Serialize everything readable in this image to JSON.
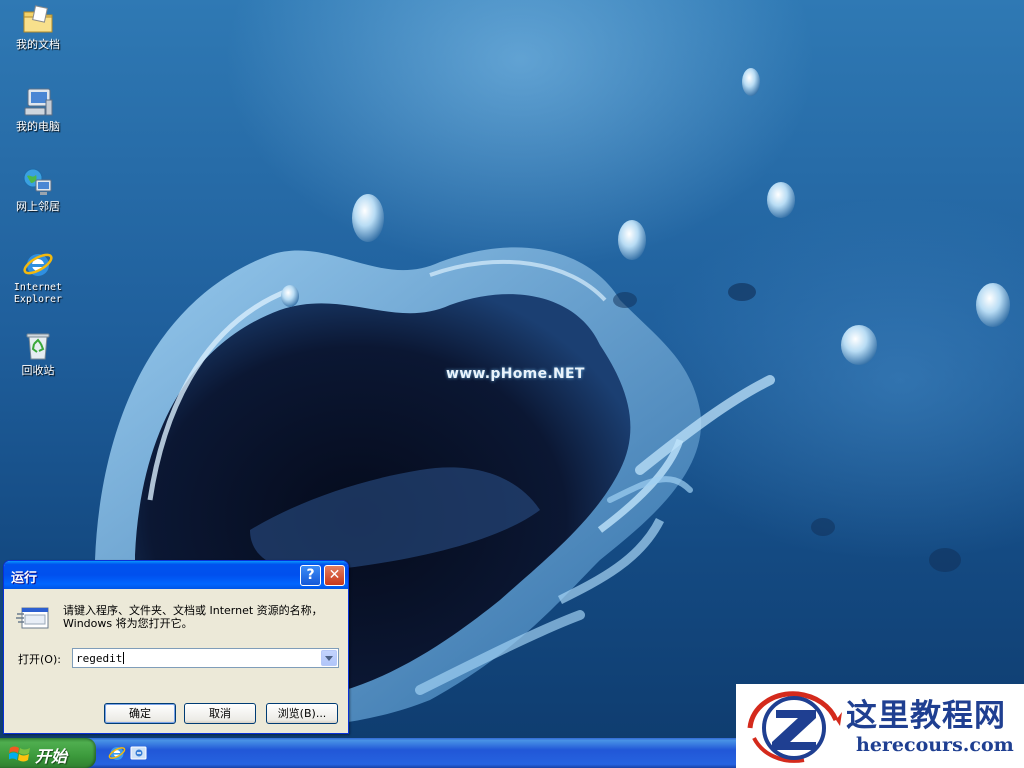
{
  "desktop": {
    "watermark": "www.pHome.NET",
    "icons": [
      {
        "label": "我的文档"
      },
      {
        "label": "我的电脑"
      },
      {
        "label": "网上邻居"
      },
      {
        "label": "Internet Explorer"
      },
      {
        "label": "回收站"
      }
    ]
  },
  "run_dialog": {
    "title": "运行",
    "help_glyph": "?",
    "close_glyph": "✕",
    "description": "请键入程序、文件夹、文档或 Internet 资源的名称，Windows 将为您打开它。",
    "open_label": "打开(O):",
    "command_value": "regedit",
    "ok_label": "确定",
    "cancel_label": "取消",
    "browse_label": "浏览(B)..."
  },
  "taskbar": {
    "start_label": "开始",
    "quick_launch": [
      "internet-explorer-icon",
      "show-desktop-icon"
    ]
  },
  "brand": {
    "title": "这里教程网",
    "url": "herecours.com"
  },
  "colors": {
    "titlebar": "#0053ee",
    "start_button": "#3c9a3c",
    "brand_text": "#1f3f91",
    "brand_accent": "#d42a1c"
  }
}
